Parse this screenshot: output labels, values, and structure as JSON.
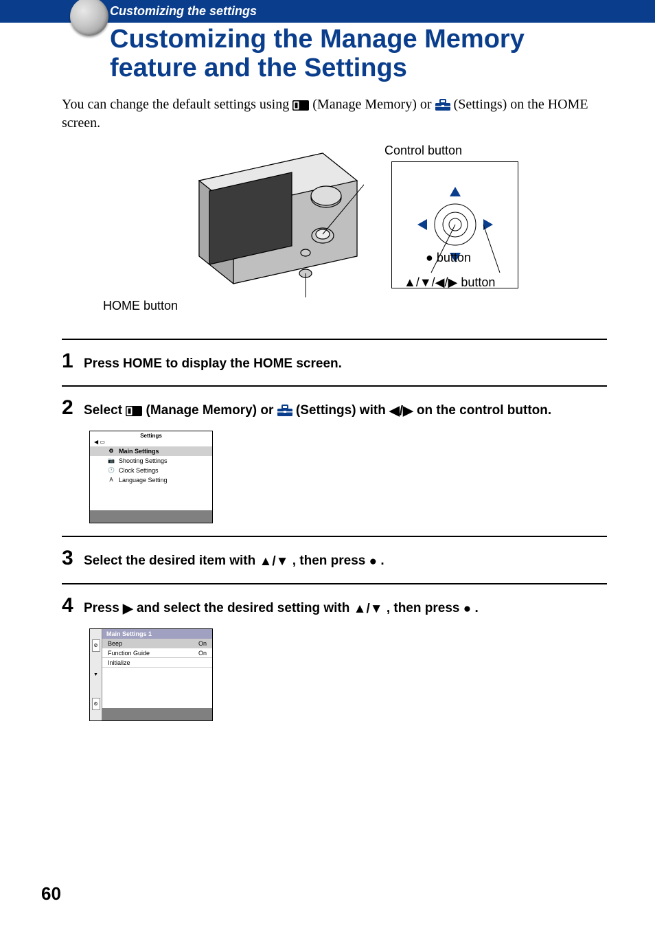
{
  "header": {
    "section_label": "Customizing the settings",
    "title": "Customizing the Manage Memory feature and the Settings"
  },
  "intro": {
    "before_icon1": "You can change the default settings using ",
    "after_icon1": " (Manage Memory) or ",
    "after_icon2": " (Settings) on the HOME screen."
  },
  "diagram_labels": {
    "control_button": "Control button",
    "center_button": "● button",
    "dpad_button": "▲/▼/◀/▶ button",
    "home_button": "HOME button"
  },
  "steps": [
    {
      "num": "1",
      "text_plain": "Press HOME to display the HOME screen."
    },
    {
      "num": "2",
      "segments": {
        "a": "Select ",
        "b": " (Manage Memory) or ",
        "c": " (Settings) with ",
        "d": " on the control button."
      },
      "screenshot1": {
        "title": "Settings",
        "items": [
          {
            "icon": "⚙",
            "label": "Main Settings",
            "selected": true
          },
          {
            "icon": "📷",
            "label": "Shooting Settings",
            "selected": false
          },
          {
            "icon": "🕐",
            "label": "Clock Settings",
            "selected": false
          },
          {
            "icon": "A",
            "label": "Language Setting",
            "selected": false
          }
        ]
      }
    },
    {
      "num": "3",
      "segments": {
        "a": "Select the desired item with ",
        "b": ", then press ",
        "c": "."
      }
    },
    {
      "num": "4",
      "segments": {
        "a": "Press ",
        "b": " and select the desired setting with ",
        "c": ", then press ",
        "d": "."
      },
      "screenshot2": {
        "header": "Main Settings 1",
        "rows": [
          {
            "label": "Beep",
            "value": "On",
            "selected": true
          },
          {
            "label": "Function Guide",
            "value": "On",
            "selected": false
          },
          {
            "label": "Initialize",
            "value": "",
            "selected": false
          }
        ]
      }
    }
  ],
  "icons": {
    "manage_memory_alt": "Manage Memory icon",
    "settings_alt": "Settings toolbox icon"
  },
  "arrows": {
    "left_right": "◀/▶",
    "up_down": "▲/▼",
    "right": "▶"
  },
  "page_number": "60"
}
